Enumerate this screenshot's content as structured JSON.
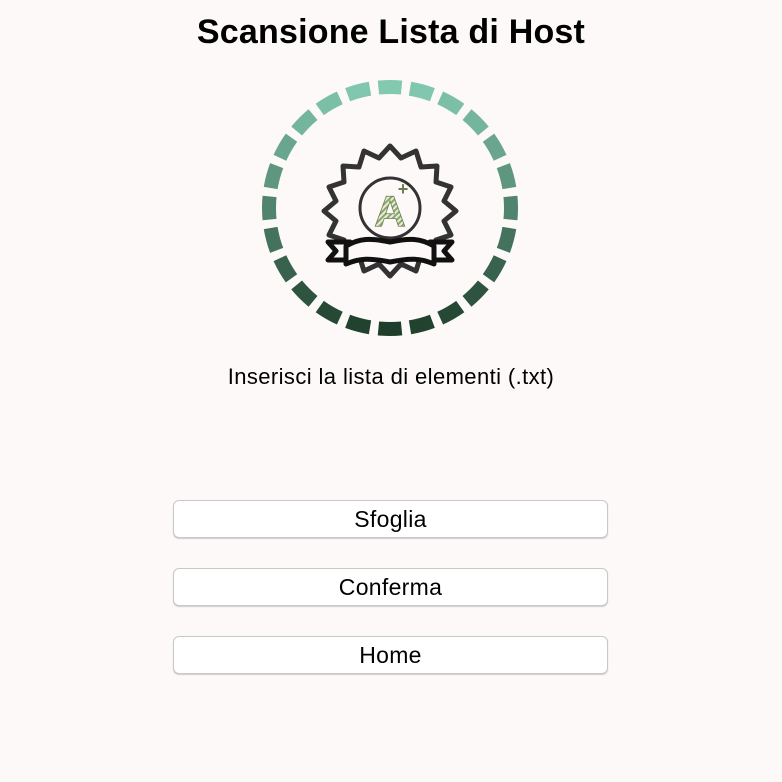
{
  "window": {
    "title": "Scansione Lista di Host"
  },
  "logo": {
    "icon": "certificate-badge-icon",
    "ring_color_top": "#86cdb4",
    "ring_color_bottom": "#1c3b28",
    "badge_letter": "A",
    "badge_plus": "+"
  },
  "main": {
    "instruction": "Inserisci la lista di elementi (.txt)"
  },
  "buttons": {
    "browse_label": "Sfoglia",
    "confirm_label": "Conferma",
    "home_label": "Home"
  }
}
